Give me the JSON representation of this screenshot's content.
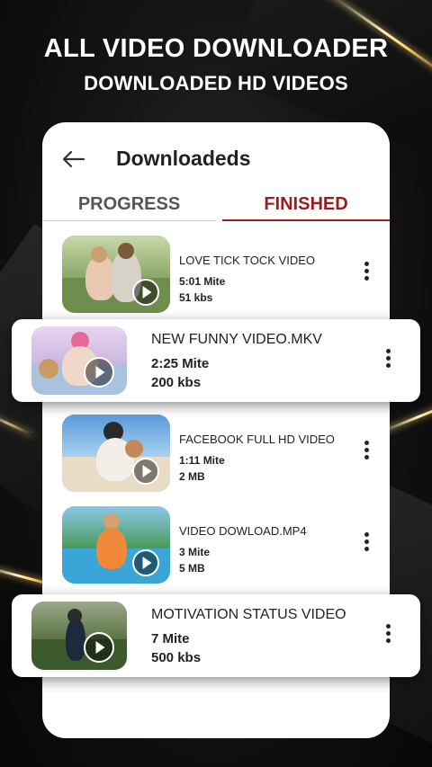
{
  "promo": {
    "title": "ALL VIDEO DOWNLOADER",
    "subtitle": "DOWNLOADED HD VIDEOS"
  },
  "screen": {
    "title": "Downloadeds",
    "back_icon": "arrow-left-icon",
    "tabs": [
      {
        "label": "PROGRESS",
        "active": false
      },
      {
        "label": "FINISHED",
        "active": true
      }
    ],
    "accent_color": "#9b1c1c"
  },
  "videos": [
    {
      "title": "LOVE TICK TOCK VIDEO",
      "duration": "5:01  Mite",
      "size": "51 kbs",
      "highlighted": false
    },
    {
      "title": "NEW FUNNY VIDEO.MKV",
      "duration": "2:25 Mite",
      "size": "200 kbs",
      "highlighted": true
    },
    {
      "title": "FACEBOOK FULL HD VIDEO",
      "duration": "1:11 Mite",
      "size": "2 MB",
      "highlighted": false
    },
    {
      "title": "VIDEO DOWLOAD.MP4",
      "duration": "3 Mite",
      "size": "5 MB",
      "highlighted": false
    },
    {
      "title": "MOTIVATION STATUS VIDEO",
      "duration": "7 Mite",
      "size": "500 kbs",
      "highlighted": true
    }
  ]
}
